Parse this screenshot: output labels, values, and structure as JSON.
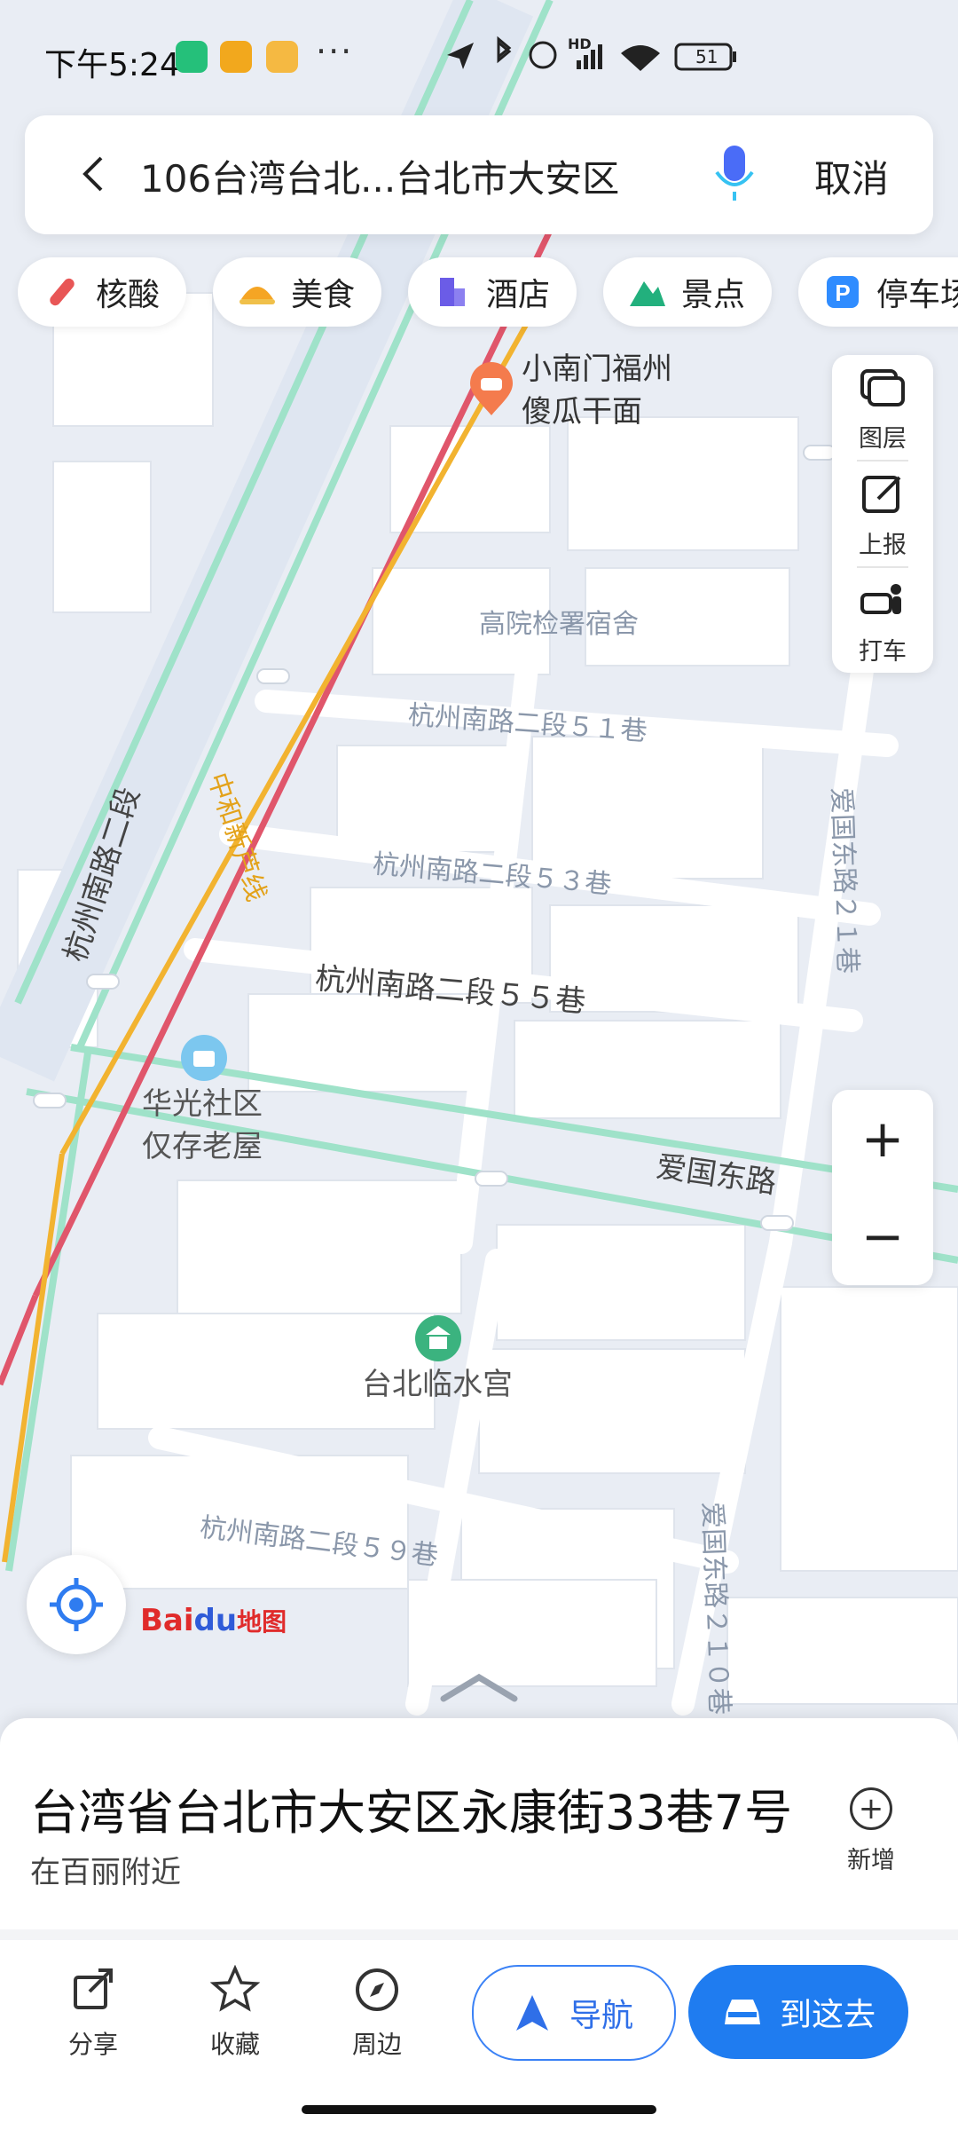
{
  "status_bar": {
    "time": "下午5:24",
    "battery": "51",
    "more": "···",
    "network": "HD"
  },
  "search": {
    "query": "106台湾台北...台北市大安区",
    "cancel_label": "取消"
  },
  "categories": [
    {
      "label": "核酸",
      "icon": "test-tube-icon",
      "color": "#e85656"
    },
    {
      "label": "美食",
      "icon": "food-icon",
      "color": "#f5a524"
    },
    {
      "label": "酒店",
      "icon": "hotel-icon",
      "color": "#6b5ce7"
    },
    {
      "label": "景点",
      "icon": "mountain-icon",
      "color": "#22b07d"
    },
    {
      "label": "停车场",
      "icon": "parking-icon",
      "color": "#2f8cff"
    }
  ],
  "tools": [
    {
      "label": "图层",
      "icon": "layers-icon"
    },
    {
      "label": "上报",
      "icon": "report-icon"
    },
    {
      "label": "打车",
      "icon": "taxi-icon"
    }
  ],
  "zoom": {
    "in_label": "+",
    "out_label": "−"
  },
  "map": {
    "poi_food": {
      "line1": "小南门福州",
      "line2": "傻瓜干面"
    },
    "poi_house": {
      "line1": "华光社区",
      "line2": "仅存老屋"
    },
    "poi_temple": "台北临水宫",
    "building": "高院检署宿舍",
    "road_a": "杭州南路二段５１巷",
    "road_b": "杭州南路二段５３巷",
    "road_c": "杭州南路二段５５巷",
    "road_d": "杭州南路二段５９巷",
    "road_e": "杭州南路二段",
    "road_f": "爱国东路",
    "road_g": "爱国东路２１巷",
    "road_h": "爱国东路２１０巷",
    "metro": "中和新芦线",
    "logo_text": "Bai地图"
  },
  "place": {
    "title": "台湾省台北市大安区永康街33巷7号",
    "subtitle": "在百丽附近",
    "add_label": "新增"
  },
  "actions": {
    "share": "分享",
    "favorite": "收藏",
    "nearby": "周边",
    "navigate": "导航",
    "go_here": "到这去"
  },
  "colors": {
    "accent": "#1f7cf0",
    "road_green": "#8fe0c4",
    "metro": "#f2b330",
    "road_red": "#e0566b"
  }
}
